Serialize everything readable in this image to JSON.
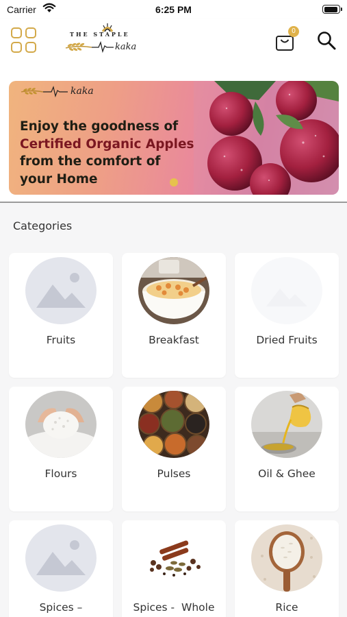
{
  "status_bar": {
    "carrier": "Carrier",
    "time": "6:25 PM"
  },
  "header": {
    "logo": {
      "line1": "THE STAPLE",
      "line2": "kaka"
    },
    "cart_count": "0",
    "icons": {
      "menu": "grid-menu-icon",
      "cart": "shopping-bag-icon",
      "search": "search-icon"
    },
    "accent_color": "#d3a949"
  },
  "banner": {
    "brand": "kaka",
    "headline": {
      "line1": "Enjoy the goodness of",
      "line2": "Certified Organic Apples",
      "line3": "from the comfort of",
      "line4": "your Home"
    },
    "accent_color": "#7a1721"
  },
  "categories": {
    "title": "Categories",
    "items": [
      {
        "label": "Fruits",
        "image": "placeholder-image-icon"
      },
      {
        "label": "Breakfast",
        "image": "breakfast-bowl-photo"
      },
      {
        "label": "Dried Fruits",
        "image": "faded-placeholder"
      },
      {
        "label": "Flours",
        "image": "flour-hands-photo"
      },
      {
        "label": "Pulses",
        "image": "pulses-bowls-photo"
      },
      {
        "label": "Oil & Ghee",
        "image": "oil-pour-photo"
      },
      {
        "label": "Spices –",
        "image": "placeholder-image-icon"
      },
      {
        "label": "Spices -  Whole",
        "image": "whole-spices-photo"
      },
      {
        "label": "Rice",
        "image": "rice-scoop-photo"
      }
    ]
  }
}
